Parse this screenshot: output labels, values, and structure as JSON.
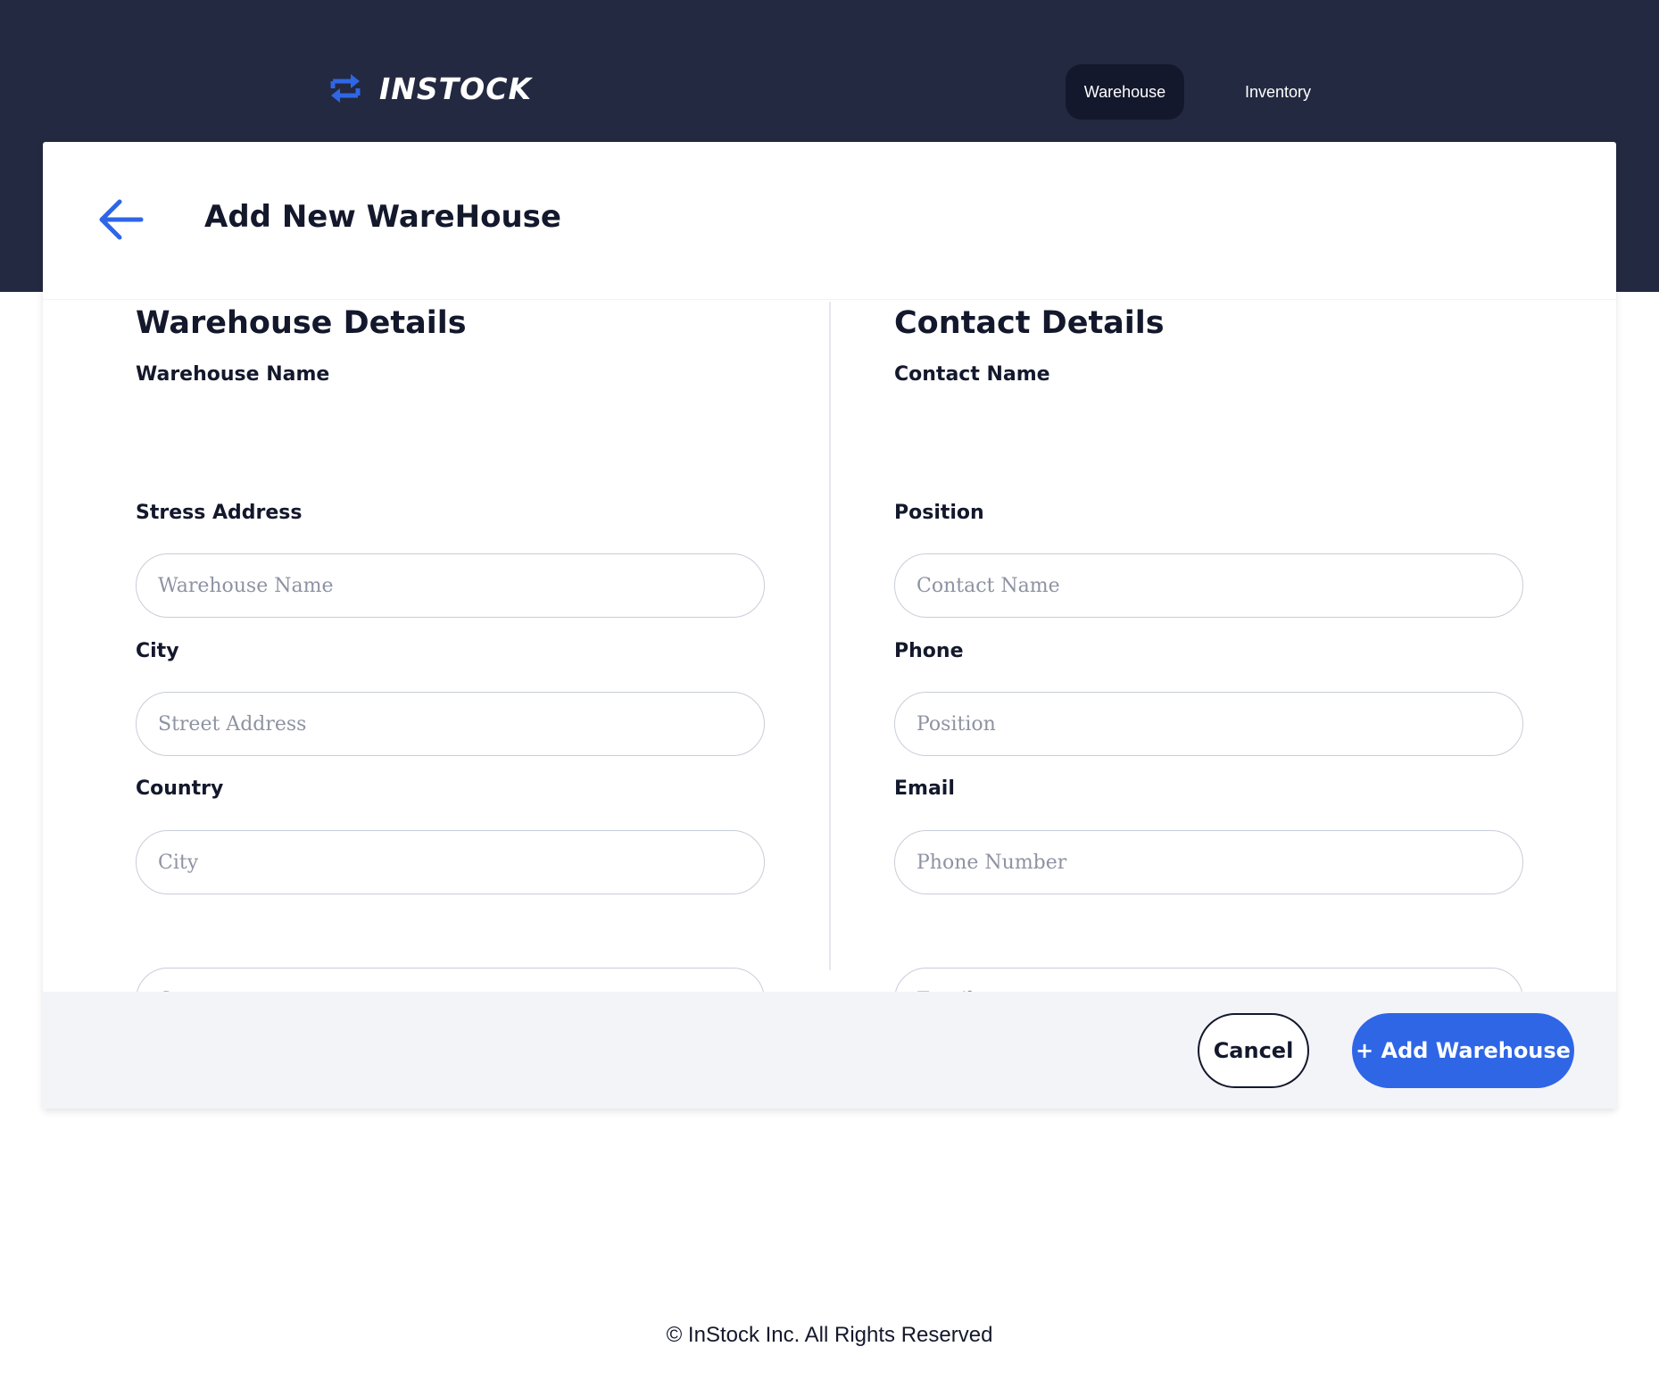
{
  "brand": {
    "name": "INSTOCK",
    "icon": "swap-arrows-icon"
  },
  "nav": {
    "items": [
      {
        "label": "Warehouse",
        "active": true
      },
      {
        "label": "Inventory",
        "active": false
      }
    ]
  },
  "page": {
    "title": "Add New WareHouse",
    "back_icon": "arrow-left-icon"
  },
  "warehouse": {
    "title": "Warehouse Details",
    "fields": [
      {
        "label": "Warehouse Name",
        "placeholder": "Warehouse Name",
        "value": ""
      },
      {
        "label": "Stress Address",
        "placeholder": "Street Address",
        "value": ""
      },
      {
        "label": "City",
        "placeholder": "City",
        "value": ""
      },
      {
        "label": "Country",
        "placeholder": "Country",
        "value": ""
      }
    ]
  },
  "contact": {
    "title": "Contact Details",
    "fields": [
      {
        "label": "Contact Name",
        "placeholder": "Contact Name",
        "value": ""
      },
      {
        "label": "Position",
        "placeholder": "Position",
        "value": ""
      },
      {
        "label": "Phone",
        "placeholder": "Phone Number",
        "value": ""
      },
      {
        "label": "Email",
        "placeholder": "Email",
        "value": ""
      }
    ]
  },
  "actions": {
    "cancel_label": "Cancel",
    "add_label": "+ Add Warehouse"
  },
  "footer": {
    "text": "© InStock Inc. All Rights Reserved"
  },
  "colors": {
    "header_bg": "#232940",
    "active_nav_bg": "#13182C",
    "accent": "#2e66e6",
    "text": "#13182C",
    "footer_bar_bg": "#f3f4f8"
  }
}
